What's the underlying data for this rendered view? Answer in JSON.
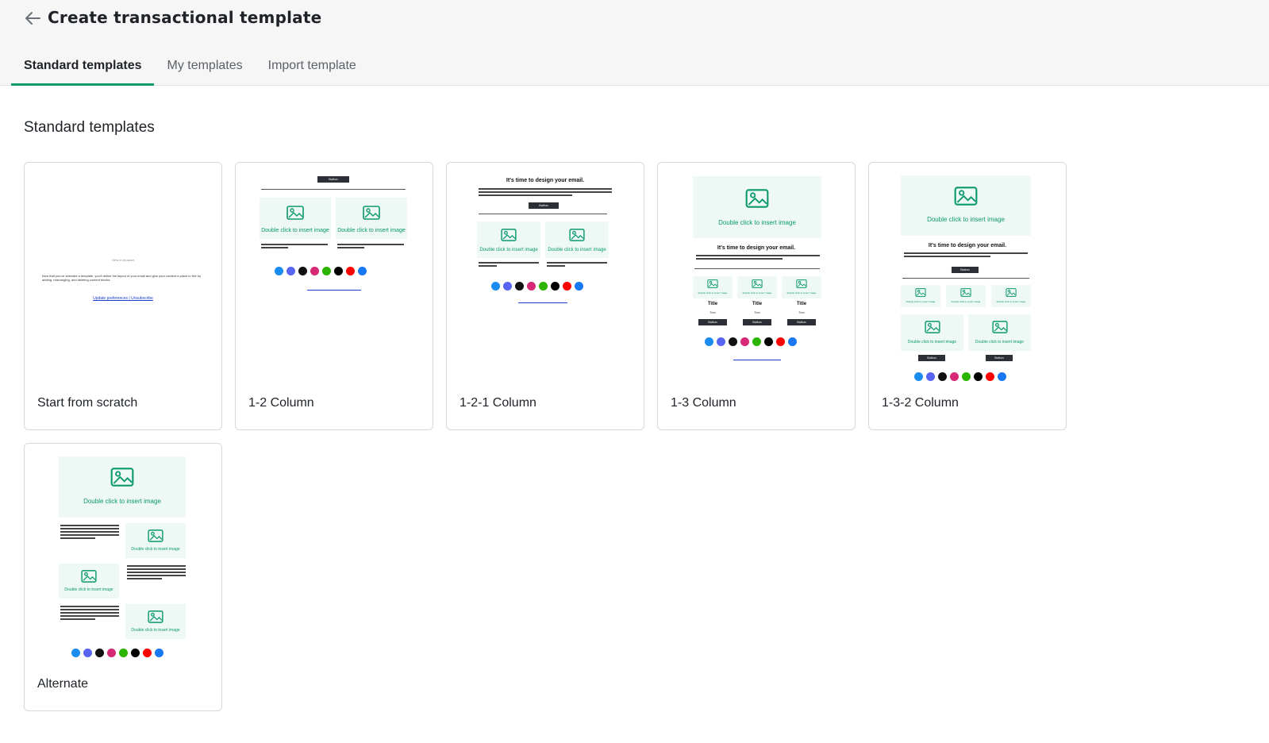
{
  "header": {
    "back_icon": "arrow-left-icon",
    "title": "Create transactional template"
  },
  "tabs": [
    {
      "label": "Standard templates",
      "active": true
    },
    {
      "label": "My templates",
      "active": false
    },
    {
      "label": "Import template",
      "active": false
    }
  ],
  "section_title": "Standard templates",
  "thumb_text": {
    "view_in_browser": "View in browser",
    "scratch_body": "Now that you've selected a template, you'll define the layout of your email and give your content a place to live by adding, rearranging, and deleting content blocks.",
    "update_prefs": "Update preferences",
    "separator": "|",
    "unsubscribe": "Unsubscribe",
    "button": "Button",
    "heading": "It's time to design your email.",
    "image_caption": "Double click to insert image",
    "col_title": "Title",
    "col_text": "Text"
  },
  "templates": [
    {
      "label": "Start from scratch"
    },
    {
      "label": "1-2 Column"
    },
    {
      "label": "1-2-1 Column"
    },
    {
      "label": "1-3 Column"
    },
    {
      "label": "1-3-2 Column"
    },
    {
      "label": "Alternate"
    }
  ],
  "colors": {
    "accent": "#0b996e",
    "image_bg": "#eef8f5",
    "button_bg": "#2d2f36"
  },
  "social_icons": [
    "appstore-icon",
    "discord-icon",
    "googleplay-icon",
    "instagram-icon",
    "naver-icon",
    "x-icon",
    "youtube-icon",
    "facebook-icon"
  ]
}
